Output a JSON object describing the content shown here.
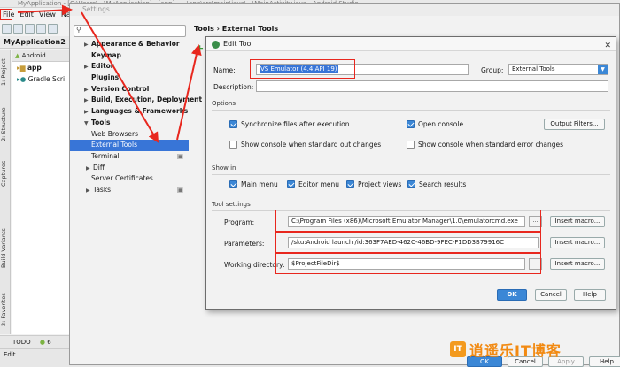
{
  "ide": {
    "title": "MyApplication - [C:\\Users\\...\\MyApplication] - [app] - ...\\app\\src\\main\\java\\...\\MainActivity.java - Android Studio",
    "menu": [
      "File",
      "Edit",
      "View",
      "Na"
    ],
    "breadcrumb": "MyApplication2",
    "project_view": "Android",
    "tree": [
      "app",
      "Gradle Scri"
    ],
    "left_tabs": [
      "1: Project",
      "2: Structure",
      "Captures",
      "Build Variants",
      "2: Favorites"
    ],
    "bottom_tabs": [
      "TODO",
      "6"
    ],
    "status": "Edit"
  },
  "settings": {
    "title": "Settings",
    "search_placeholder": "",
    "crumb": "Tools › External Tools",
    "tree": [
      {
        "label": "Appearance & Behavior",
        "bold": true,
        "arrow": "▶"
      },
      {
        "label": "Keymap",
        "bold": true,
        "arrow": ""
      },
      {
        "label": "Editor",
        "bold": true,
        "arrow": "▶"
      },
      {
        "label": "Plugins",
        "bold": true,
        "arrow": ""
      },
      {
        "label": "Version Control",
        "bold": true,
        "arrow": "▶"
      },
      {
        "label": "Build, Execution, Deployment",
        "bold": true,
        "arrow": "▶"
      },
      {
        "label": "Languages & Frameworks",
        "bold": true,
        "arrow": "▶"
      },
      {
        "label": "Tools",
        "bold": true,
        "arrow": "▼"
      },
      {
        "label": "Web Browsers",
        "bold": false,
        "arrow": ""
      },
      {
        "label": "External Tools",
        "bold": false,
        "arrow": "",
        "selected": true
      },
      {
        "label": "Terminal",
        "bold": false,
        "arrow": ""
      },
      {
        "label": "Diff",
        "bold": false,
        "arrow": "▶"
      },
      {
        "label": "Server Certificates",
        "bold": false,
        "arrow": ""
      },
      {
        "label": "Tasks",
        "bold": false,
        "arrow": "▶"
      }
    ],
    "buttons": {
      "ok": "OK",
      "cancel": "Cancel",
      "apply": "Apply",
      "help": "Help"
    }
  },
  "edit_tool": {
    "title": "Edit Tool",
    "name_label": "Name:",
    "name_value": "VS Emulator (4.4 API 19)",
    "group_label": "Group:",
    "group_value": "External Tools",
    "description_label": "Description:",
    "description_value": "",
    "options_heading": "Options",
    "options": {
      "sync_files": {
        "label": "Synchronize files after execution",
        "checked": true
      },
      "open_console": {
        "label": "Open console",
        "checked": true
      },
      "console_stdout": {
        "label": "Show console when standard out changes",
        "checked": false
      },
      "console_stderr": {
        "label": "Show console when standard error changes",
        "checked": false
      }
    },
    "output_filters_label": "Output Filters...",
    "show_in_heading": "Show in",
    "show_in": {
      "main_menu": {
        "label": "Main menu",
        "checked": true
      },
      "editor_menu": {
        "label": "Editor menu",
        "checked": true
      },
      "project_views": {
        "label": "Project views",
        "checked": true
      },
      "search_results": {
        "label": "Search results",
        "checked": true
      }
    },
    "tool_settings_heading": "Tool settings",
    "program_label": "Program:",
    "program_value": "C:\\Program Files (x86)\\Microsoft Emulator Manager\\1.0\\emulatorcmd.exe",
    "parameters_label": "Parameters:",
    "parameters_value": "/sku:Android launch /id:363F7AED-462C-46BD-9FEC-F1DD3B79916C",
    "working_dir_label": "Working directory:",
    "working_dir_value": "$ProjectFileDir$",
    "browse_label": "...",
    "insert_macro_label": "Insert macro...",
    "ok_label": "OK",
    "cancel_label": "Cancel",
    "help_label": "Help"
  },
  "watermark": {
    "logo": "IT",
    "text": "逍遥乐IT博客"
  },
  "colors": {
    "accent": "#3b87d6",
    "highlight": "#e8271e",
    "selection": "#3875d7",
    "watermark": "#f28a12"
  }
}
